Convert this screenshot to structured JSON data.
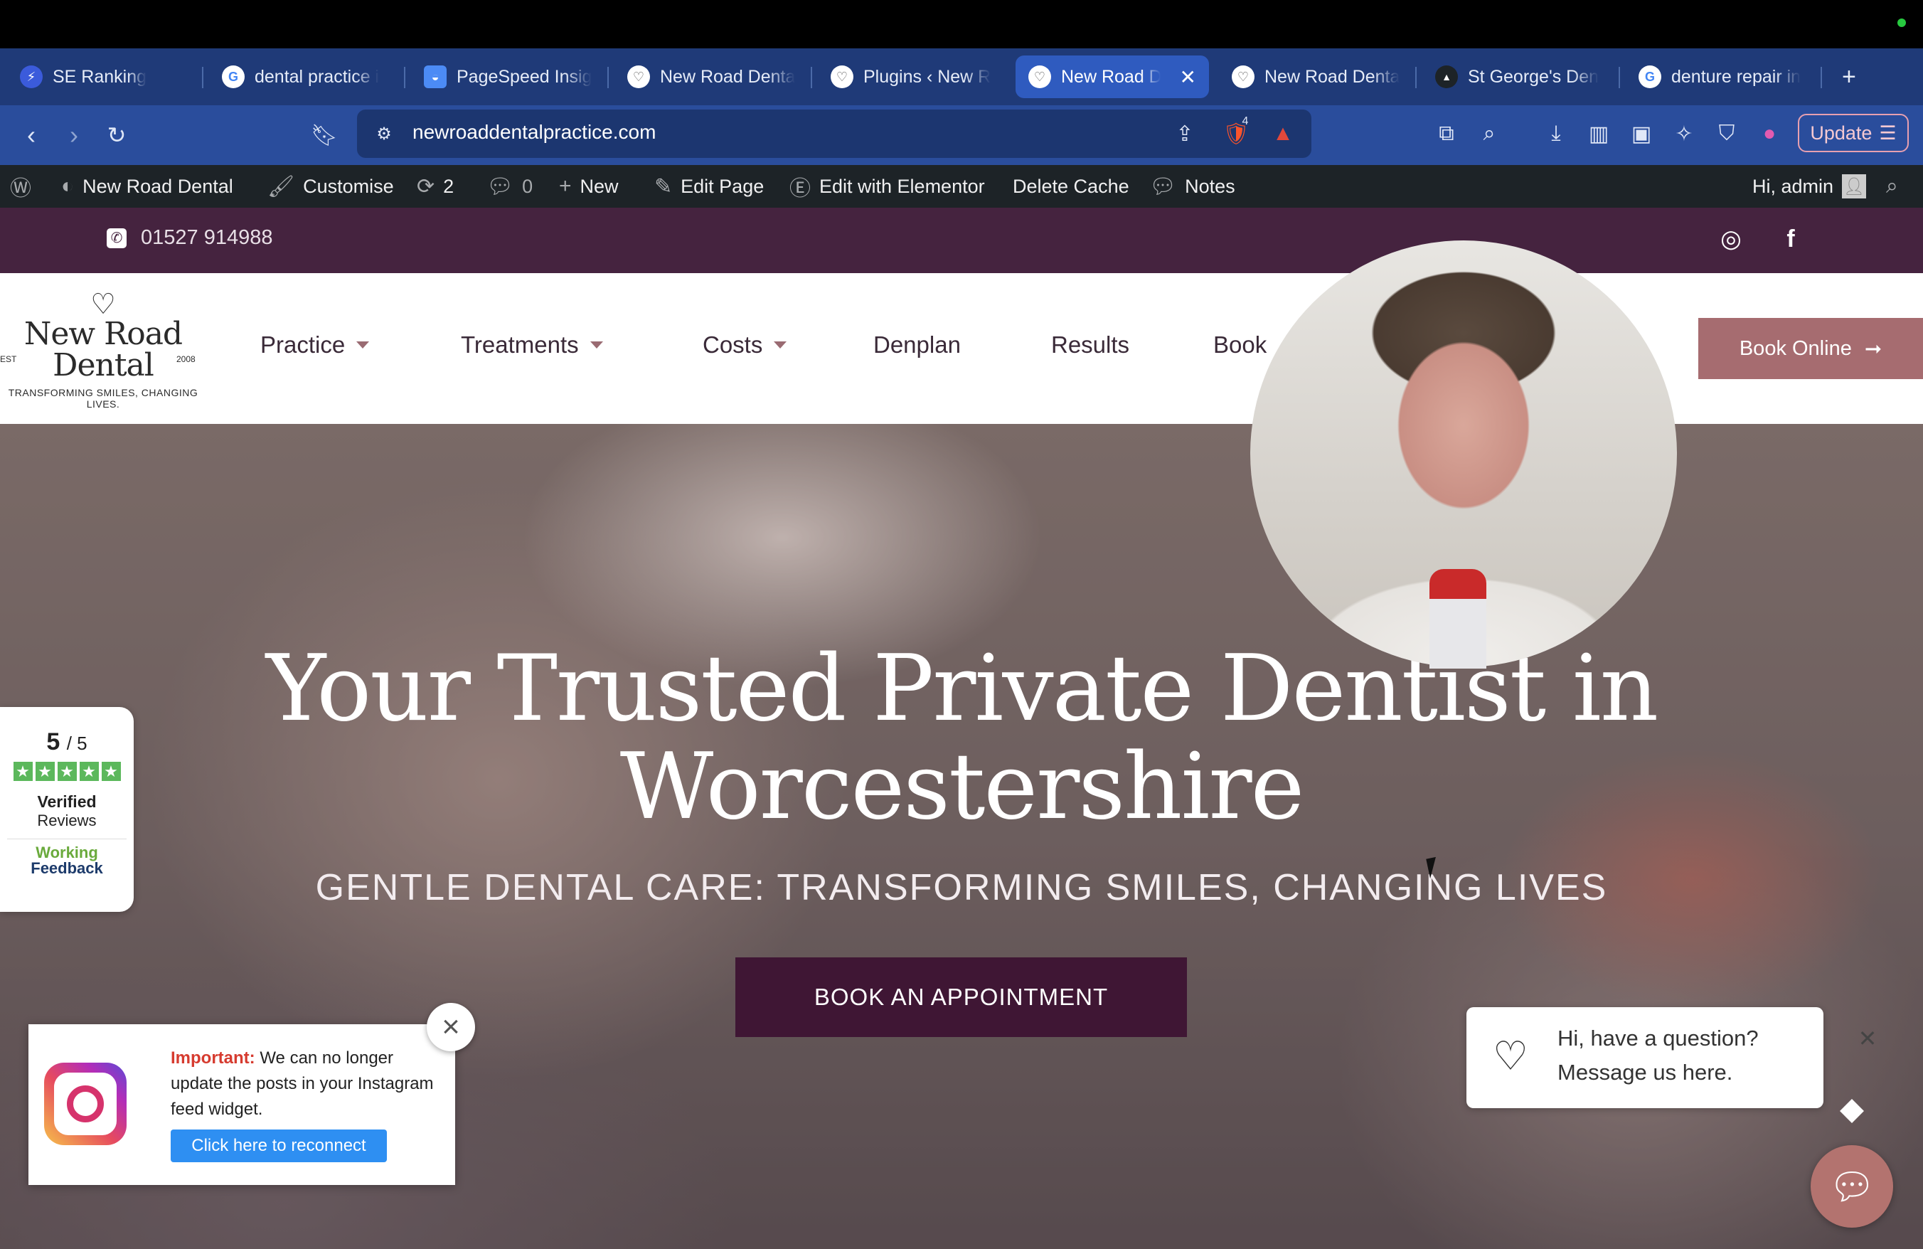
{
  "browser": {
    "tabs": [
      {
        "title": "SE Ranking",
        "favicon": "se-ranking-icon",
        "color": "#3b5bdb"
      },
      {
        "title": "dental practice i",
        "favicon": "google-icon",
        "color": "#ffffff"
      },
      {
        "title": "PageSpeed Insig",
        "favicon": "pagespeed-icon",
        "color": "#4c8bf5"
      },
      {
        "title": "New Road Denta",
        "favicon": "tooth-icon",
        "color": "#ffffff"
      },
      {
        "title": "Plugins ‹ New R",
        "favicon": "tooth-icon",
        "color": "#ffffff"
      },
      {
        "title": "New Road D",
        "favicon": "tooth-icon",
        "color": "#ffffff",
        "active": true
      },
      {
        "title": "New Road Denta",
        "favicon": "tooth-icon",
        "color": "#ffffff"
      },
      {
        "title": "St George's Den",
        "favicon": "st-george-icon",
        "color": "#1d2327"
      },
      {
        "title": "denture repair in",
        "favicon": "google-icon",
        "color": "#ffffff"
      }
    ],
    "new_tab": "+",
    "url": "newroaddentalpractice.com",
    "brave_shield_count": "4",
    "update_label": "Update"
  },
  "wp_admin": {
    "site_name": "New Road Dental",
    "customise": "Customise",
    "updates_count": "2",
    "comments_count": "0",
    "new": "New",
    "edit_page": "Edit Page",
    "edit_elementor": "Edit with Elementor",
    "delete_cache": "Delete Cache",
    "notes": "Notes",
    "greeting": "Hi, admin"
  },
  "site": {
    "phone": "01527 914988",
    "logo": {
      "name_line1": "New Road",
      "name_line2": "Dental",
      "est": "EST",
      "year": "2008",
      "tagline": "TRANSFORMING SMILES, CHANGING LIVES."
    },
    "nav": {
      "practice": "Practice",
      "treatments": "Treatments",
      "costs": "Costs",
      "denplan": "Denplan",
      "results": "Results",
      "book": "Book"
    },
    "book_online": "Book Online",
    "hero": {
      "title_line1": "Your Trusted Private Dentist in",
      "title_line2": "Worcestershire",
      "subtitle": "GENTLE DENTAL CARE: TRANSFORMING SMILES, CHANGING LIVES",
      "cta": "BOOK AN APPOINTMENT"
    },
    "reviews": {
      "score": "5",
      "out_of": "/ 5",
      "verified": "Verified",
      "reviews": "Reviews",
      "brand_line1": "Working",
      "brand_line2": "Feedback"
    },
    "instagram_notice": {
      "important": "Important:",
      "message": "We can no longer update the posts in your Instagram feed widget.",
      "button": "Click here to reconnect"
    },
    "chat": {
      "line1": "Hi, have a question?",
      "line2": "Message us here."
    }
  },
  "colors": {
    "topbar": "#45233f",
    "cta": "#3f1634",
    "book_online": "#a66c70",
    "chat_bubble": "#b3736f"
  }
}
